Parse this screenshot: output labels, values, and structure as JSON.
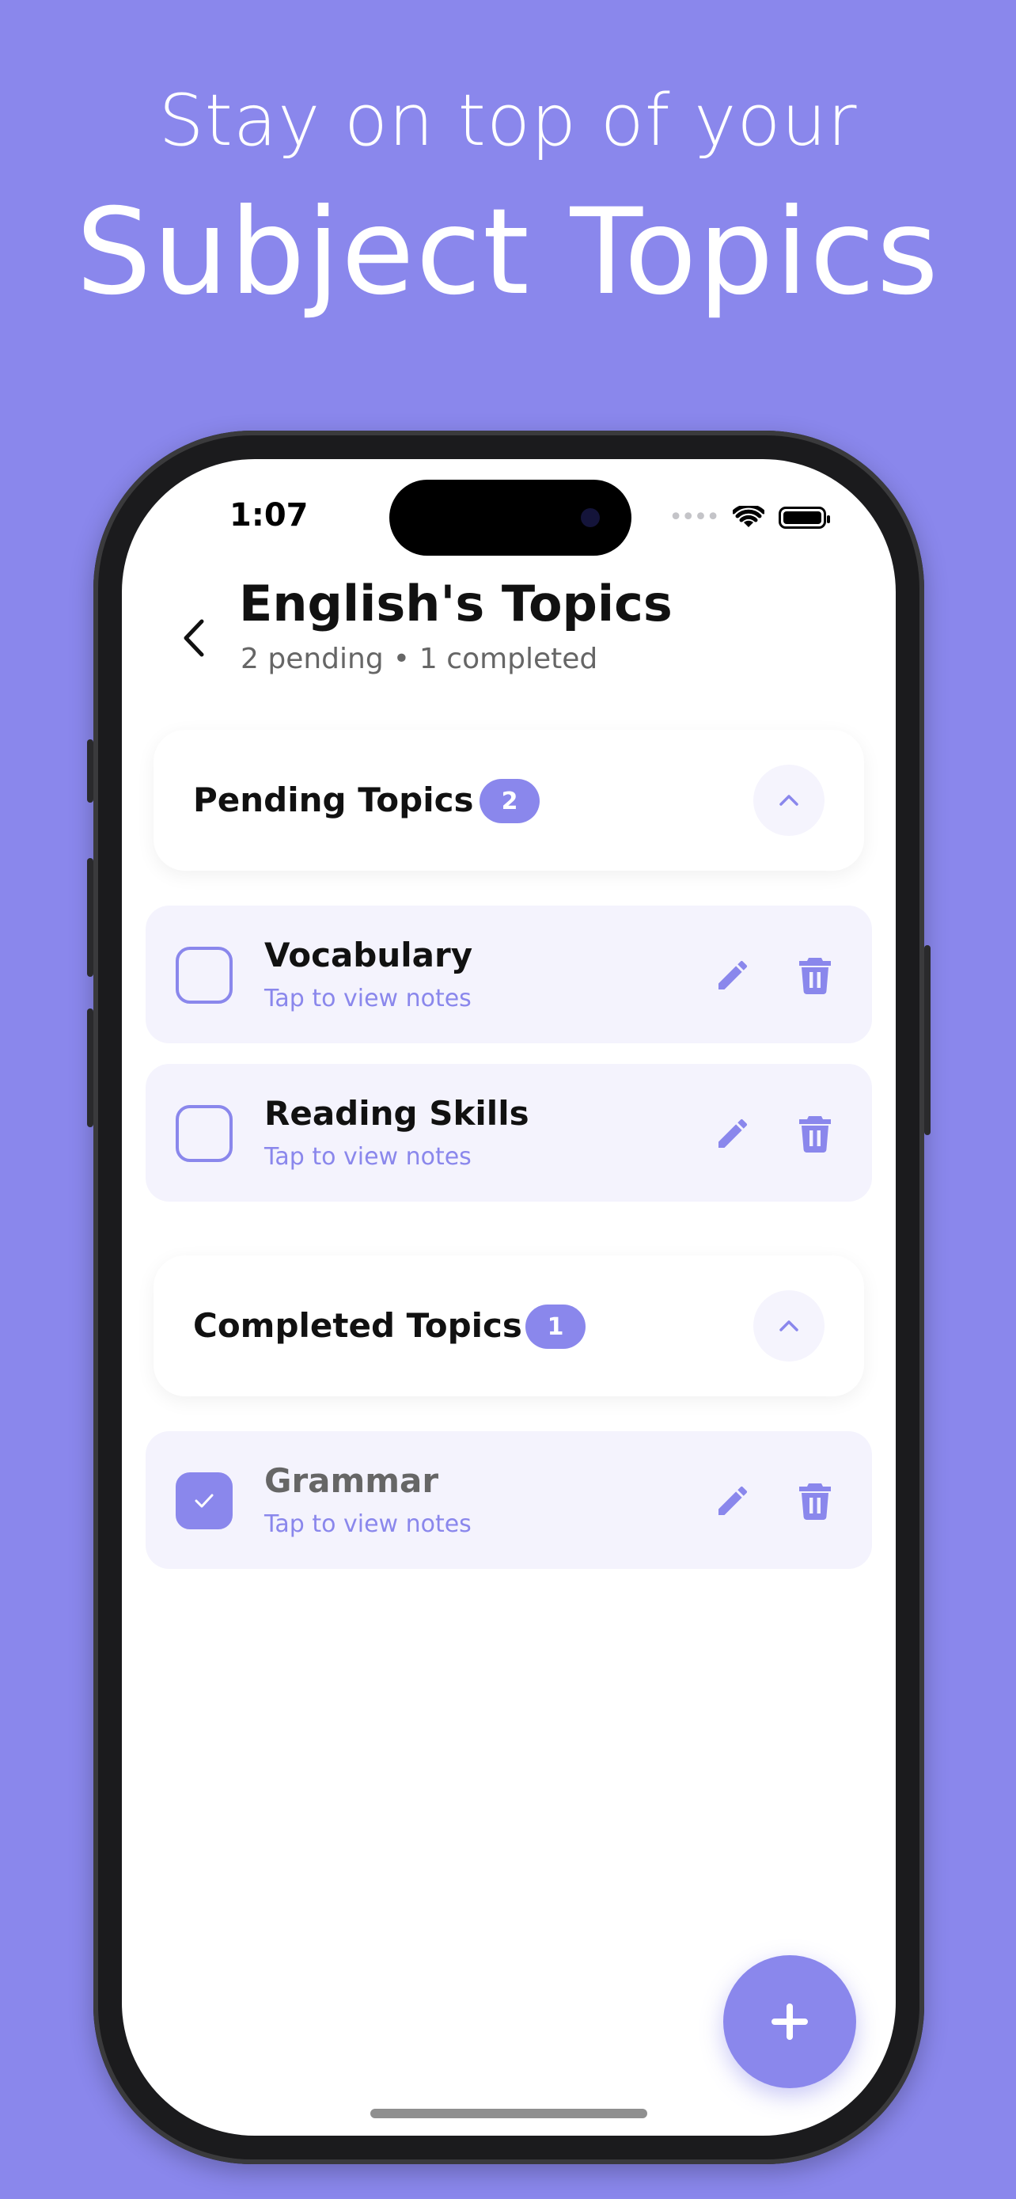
{
  "promo": {
    "line1": "Stay on top of your",
    "line2": "Subject Topics"
  },
  "status_bar": {
    "time": "1:07",
    "icons": [
      "signal-dots-icon",
      "wifi-icon",
      "battery-icon"
    ]
  },
  "header": {
    "title": "English's Topics",
    "pending_text": "2 pending",
    "separator": "•",
    "completed_text": "1 completed"
  },
  "sections": {
    "pending": {
      "title": "Pending Topics",
      "count": "2",
      "items": [
        {
          "name": "Vocabulary",
          "hint": "Tap to view notes",
          "completed": false
        },
        {
          "name": "Reading Skills",
          "hint": "Tap to view notes",
          "completed": false
        }
      ]
    },
    "completed": {
      "title": "Completed Topics",
      "count": "1",
      "items": [
        {
          "name": "Grammar",
          "hint": "Tap to view notes",
          "completed": true
        }
      ]
    }
  },
  "colors": {
    "accent": "#8a87ec",
    "item_bg": "#f4f3fd",
    "background": "#8a87ec"
  }
}
